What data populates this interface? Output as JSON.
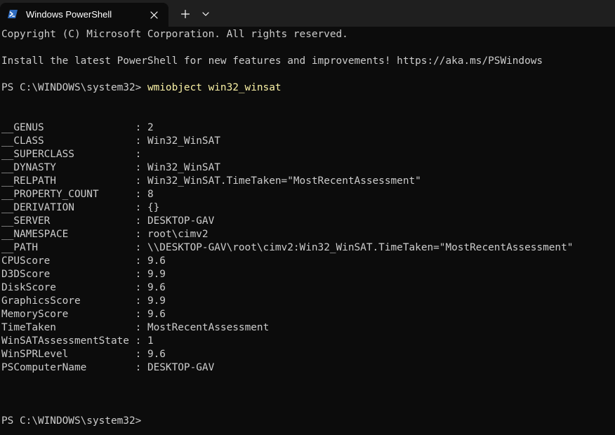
{
  "tab": {
    "title": "Windows PowerShell",
    "icon": "powershell-icon",
    "close_icon": "close-icon"
  },
  "titlebar": {
    "new_tab_icon": "plus-icon",
    "dropdown_icon": "chevron-down-icon"
  },
  "colors": {
    "background": "#0c0c0c",
    "titlebar": "#1f1f1f",
    "text": "#cccccc",
    "command": "#f9f1a5",
    "icon_accent": "#2f6cc0"
  },
  "terminal": {
    "copyright": "Copyright (C) Microsoft Corporation. All rights reserved.",
    "install_msg": "Install the latest PowerShell for new features and improvements! https://aka.ms/PSWindows",
    "prompt1": "PS C:\\WINDOWS\\system32> ",
    "command": "wmiobject win32_winsat",
    "properties": [
      {
        "name": "__GENUS",
        "value": "2"
      },
      {
        "name": "__CLASS",
        "value": "Win32_WinSAT"
      },
      {
        "name": "__SUPERCLASS",
        "value": ""
      },
      {
        "name": "__DYNASTY",
        "value": "Win32_WinSAT"
      },
      {
        "name": "__RELPATH",
        "value": "Win32_WinSAT.TimeTaken=\"MostRecentAssessment\""
      },
      {
        "name": "__PROPERTY_COUNT",
        "value": "8"
      },
      {
        "name": "__DERIVATION",
        "value": "{}"
      },
      {
        "name": "__SERVER",
        "value": "DESKTOP-GAV"
      },
      {
        "name": "__NAMESPACE",
        "value": "root\\cimv2"
      },
      {
        "name": "__PATH",
        "value": "\\\\DESKTOP-GAV\\root\\cimv2:Win32_WinSAT.TimeTaken=\"MostRecentAssessment\""
      },
      {
        "name": "CPUScore",
        "value": "9.6"
      },
      {
        "name": "D3DScore",
        "value": "9.9"
      },
      {
        "name": "DiskScore",
        "value": "9.6"
      },
      {
        "name": "GraphicsScore",
        "value": "9.9"
      },
      {
        "name": "MemoryScore",
        "value": "9.6"
      },
      {
        "name": "TimeTaken",
        "value": "MostRecentAssessment"
      },
      {
        "name": "WinSATAssessmentState",
        "value": "1"
      },
      {
        "name": "WinSPRLevel",
        "value": "9.6"
      },
      {
        "name": "PSComputerName",
        "value": "DESKTOP-GAV"
      }
    ],
    "prompt2": "PS C:\\WINDOWS\\system32>"
  }
}
